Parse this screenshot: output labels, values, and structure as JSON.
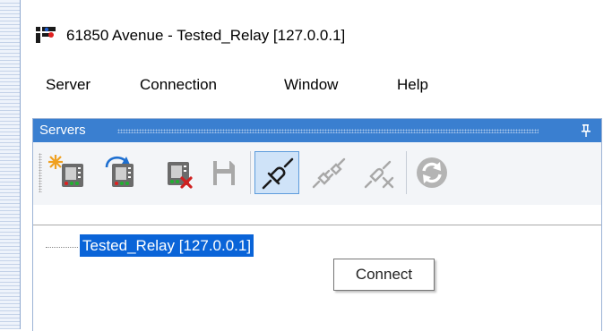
{
  "window": {
    "title": "61850 Avenue - Tested_Relay [127.0.0.1]"
  },
  "menubar": {
    "items": [
      "Server",
      "Connection",
      "Window",
      "Help"
    ]
  },
  "panel": {
    "title": "Servers"
  },
  "toolbar": {
    "buttons": [
      {
        "name": "new-server",
        "icon": "new-server-icon",
        "enabled": true
      },
      {
        "name": "import-server",
        "icon": "import-server-icon",
        "enabled": true
      },
      {
        "name": "remove-server",
        "icon": "remove-server-icon",
        "enabled": true
      },
      {
        "name": "save",
        "icon": "save-icon",
        "enabled": false
      },
      {
        "name": "connect",
        "icon": "connect-icon",
        "enabled": true,
        "active": true
      },
      {
        "name": "disconnect",
        "icon": "disconnect-icon",
        "enabled": false
      },
      {
        "name": "disconnect-all",
        "icon": "disconnect-all-icon",
        "enabled": false
      },
      {
        "name": "refresh",
        "icon": "refresh-icon",
        "enabled": false
      }
    ]
  },
  "tree": {
    "nodes": [
      {
        "label": "Tested_Relay [127.0.0.1]",
        "selected": true
      }
    ]
  },
  "tooltip": {
    "text": "Connect"
  },
  "colors": {
    "panel_header": "#3a7fd0",
    "selection": "#0a64d8",
    "active_button": "#cfe3f8"
  }
}
